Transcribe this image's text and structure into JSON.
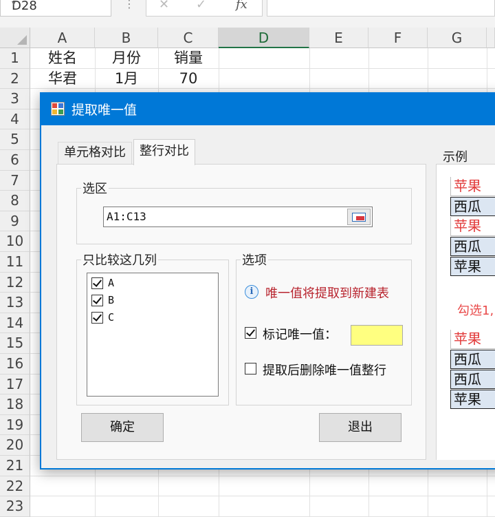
{
  "formula_bar": {
    "name_box": "D28",
    "name_box_dropdown": "▾",
    "separator": "⋮",
    "cancel_glyph": "✕",
    "confirm_glyph": "✓",
    "fx_label": "fx",
    "formula": ""
  },
  "sheet": {
    "columns": [
      "A",
      "B",
      "C",
      "D",
      "E",
      "F",
      "G"
    ],
    "selected_column": "D",
    "rows": [
      "1",
      "2",
      "3",
      "4",
      "5",
      "6",
      "7",
      "8",
      "9",
      "10",
      "11",
      "12",
      "13",
      "14",
      "15",
      "16",
      "17",
      "18",
      "19",
      "20",
      "21",
      "22",
      "23"
    ],
    "cells": {
      "A1": "姓名",
      "B1": "月份",
      "C1": "销量",
      "A2": "华君",
      "B2": "1月",
      "C2": "70"
    }
  },
  "dialog": {
    "title": "提取唯一值",
    "tabs": [
      {
        "label": "单元格对比",
        "active": false
      },
      {
        "label": "整行对比",
        "active": true
      }
    ],
    "selection": {
      "label": "选区",
      "value": "A1:C13"
    },
    "compare_columns": {
      "label": "只比较这几列",
      "items": [
        {
          "label": "A",
          "checked": true
        },
        {
          "label": "B",
          "checked": true
        },
        {
          "label": "C",
          "checked": true
        }
      ]
    },
    "options": {
      "label": "选项",
      "info_icon": "i",
      "info_text": "唯一值将提取到新建表",
      "mark_unique": {
        "label": "标记唯一值：",
        "checked": true,
        "color": "#ffff80"
      },
      "delete_rows": {
        "label": "提取后删除唯一值整行",
        "checked": false
      }
    },
    "ok_button": "确定",
    "exit_button": "退出",
    "example": {
      "label": "示例",
      "table_top": [
        {
          "text": "苹果",
          "style": "red"
        },
        {
          "text": "西瓜",
          "style": "blue"
        },
        {
          "text": "苹果",
          "style": "red"
        },
        {
          "text": "西瓜",
          "style": "blue"
        },
        {
          "text": "苹果",
          "style": "blue"
        }
      ],
      "note": "勾选1,",
      "table_bottom": [
        {
          "text": "苹果",
          "style": "red"
        },
        {
          "text": "西瓜",
          "style": "blue"
        },
        {
          "text": "西瓜",
          "style": "blue"
        },
        {
          "text": "苹果",
          "style": "blue"
        }
      ]
    }
  }
}
